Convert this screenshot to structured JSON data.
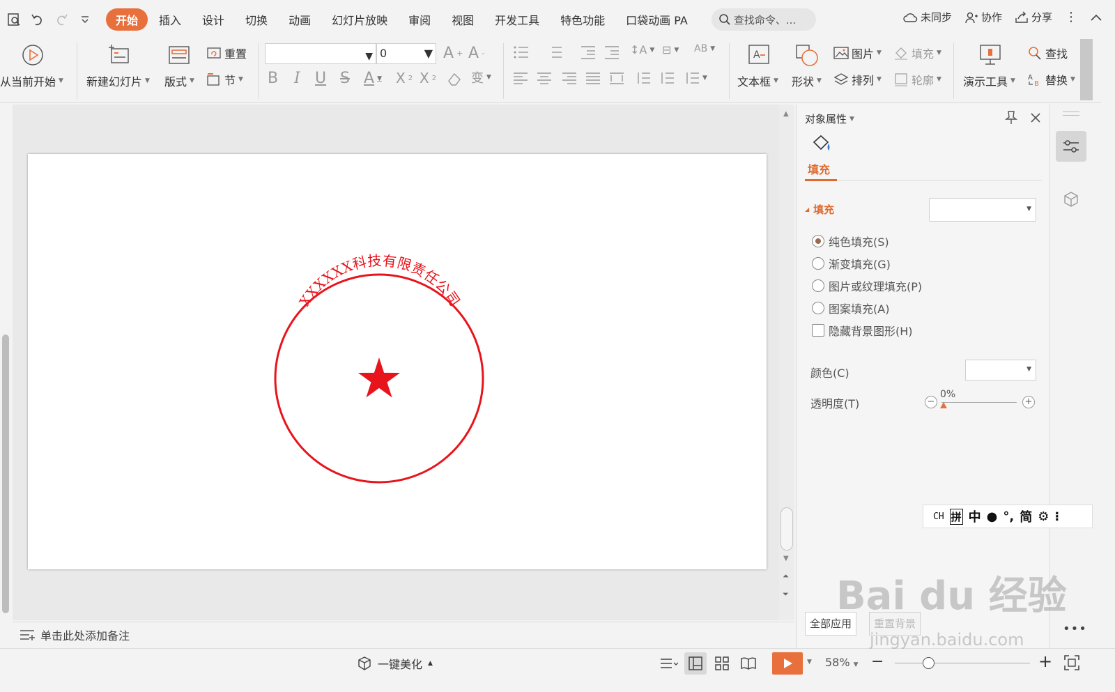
{
  "menubar": {
    "tabs": [
      "开始",
      "插入",
      "设计",
      "切换",
      "动画",
      "幻灯片放映",
      "审阅",
      "视图",
      "开发工具",
      "特色功能",
      "口袋动画 PA"
    ],
    "active_tab": "开始",
    "search_placeholder": "查找命令、...",
    "actions": {
      "sync": "未同步",
      "collab": "协作",
      "share": "分享"
    }
  },
  "ribbon": {
    "play_from_current": "从当前开始",
    "new_slide": "新建幻灯片",
    "layout": "版式",
    "reset": "重置",
    "section": "节",
    "font_size": "0",
    "text_box": "文本框",
    "shape": "形状",
    "picture": "图片",
    "arrange": "排列",
    "fill": "填充",
    "outline": "轮廓",
    "presenter_tools": "演示工具",
    "find": "查找",
    "replace": "替换"
  },
  "slide": {
    "seal_text": "XXXXXX科技有限责任公司",
    "seal_color": "#e8141c"
  },
  "notes": {
    "placeholder": "单击此处添加备注"
  },
  "pane": {
    "title": "对象属性",
    "tab_label": "填充",
    "section_label": "填充",
    "options": [
      {
        "label": "纯色填充(S)",
        "selected": true,
        "type": "radio"
      },
      {
        "label": "渐变填充(G)",
        "selected": false,
        "type": "radio"
      },
      {
        "label": "图片或纹理填充(P)",
        "selected": false,
        "type": "radio"
      },
      {
        "label": "图案填充(A)",
        "selected": false,
        "type": "radio"
      },
      {
        "label": "隐藏背景图形(H)",
        "selected": false,
        "type": "checkbox"
      }
    ],
    "color_label": "颜色(C)",
    "transparency_label": "透明度(T)",
    "transparency_value": "0%",
    "apply_all": "全部应用",
    "reset_bg": "重置背景"
  },
  "ime": {
    "ch": "CH",
    "pin": "拼",
    "zhong": "中",
    "jian": "简"
  },
  "status": {
    "beautify": "一键美化",
    "zoom": "58%"
  },
  "watermark": {
    "brand": "Bai du 经验",
    "url": "jingyan.baidu.com"
  },
  "colors": {
    "accent": "#e8703c",
    "seal": "#e8141c",
    "pane_accent": "#e06a2c"
  }
}
